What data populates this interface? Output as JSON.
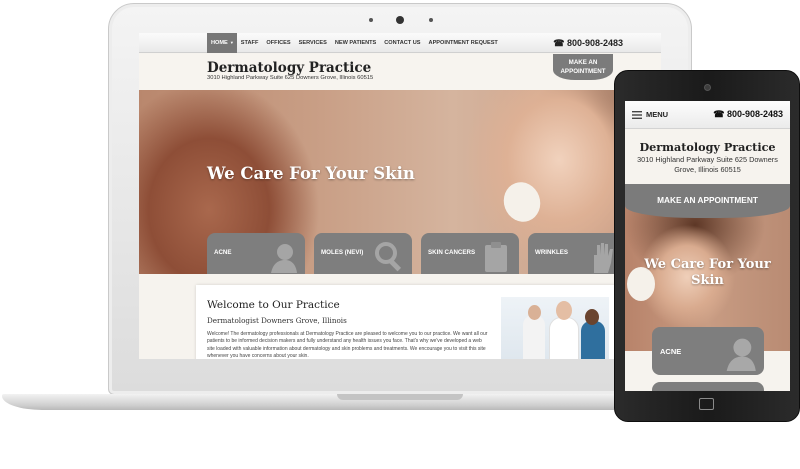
{
  "site": {
    "title": "Dermatology Practice",
    "address": "3010 Highland Parkway Suite 625 Downers Grove, Illinois 60515",
    "phone": "800-908-2483",
    "appointment_cta": "MAKE AN APPOINTMENT",
    "hero_text": "We Care For Your Skin"
  },
  "desktop": {
    "nav": [
      "HOME",
      "STAFF",
      "OFFICES",
      "SERVICES",
      "NEW PATIENTS",
      "CONTACT US",
      "APPOINTMENT REQUEST"
    ],
    "active_nav": "HOME",
    "appt_line1": "MAKE AN",
    "appt_line2": "APPOINTMENT",
    "tiles": [
      "ACNE",
      "MOLES (NEVI)",
      "SKIN CANCERS",
      "WRINKLES"
    ],
    "welcome_title": "Welcome to Our Practice",
    "welcome_subtitle": "Dermatologist Downers Grove, Illinois",
    "welcome_body": "Welcome! The dermatology professionals at Dermatology Practice are pleased to welcome you to our practice. We want all our patients to be informed decision makers and fully understand any health issues you face. That's why we've developed a web site loaded with valuable information about dermatology and skin problems and treatments. We encourage you to visit this site whenever you have concerns about your skin."
  },
  "mobile": {
    "menu_label": "MENU",
    "hero_line1": "We Care For Your",
    "hero_line2": "Skin",
    "tiles": [
      "ACNE"
    ]
  },
  "colors": {
    "tile_gray": "#7e7e7e",
    "nav_active": "#777777",
    "page_bg": "#f6f3ee"
  }
}
